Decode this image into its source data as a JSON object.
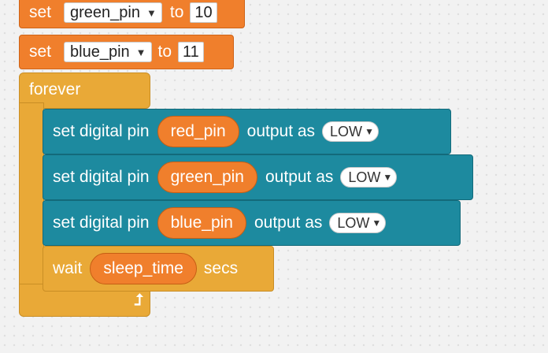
{
  "blocks": {
    "set_green": {
      "set_label": "set",
      "variable": "green_pin",
      "to_label": "to",
      "value": "10"
    },
    "set_blue": {
      "set_label": "set",
      "variable": "blue_pin",
      "to_label": "to",
      "value": "11"
    },
    "forever": {
      "label": "forever"
    },
    "pin_blocks": [
      {
        "prefix": "set digital pin",
        "pin_var": "red_pin",
        "middle": "output as",
        "level": "LOW"
      },
      {
        "prefix": "set digital pin",
        "pin_var": "green_pin",
        "middle": "output as",
        "level": "LOW"
      },
      {
        "prefix": "set digital pin",
        "pin_var": "blue_pin",
        "middle": "output as",
        "level": "LOW"
      }
    ],
    "wait": {
      "label": "wait",
      "variable": "sleep_time",
      "unit": "secs"
    }
  },
  "icons": {
    "dropdown": "caret-down-icon",
    "loop": "loop-arrow-icon"
  },
  "colors": {
    "looks": "#f07f2c",
    "robot": "#1d8a9f",
    "control": "#e9a937"
  }
}
